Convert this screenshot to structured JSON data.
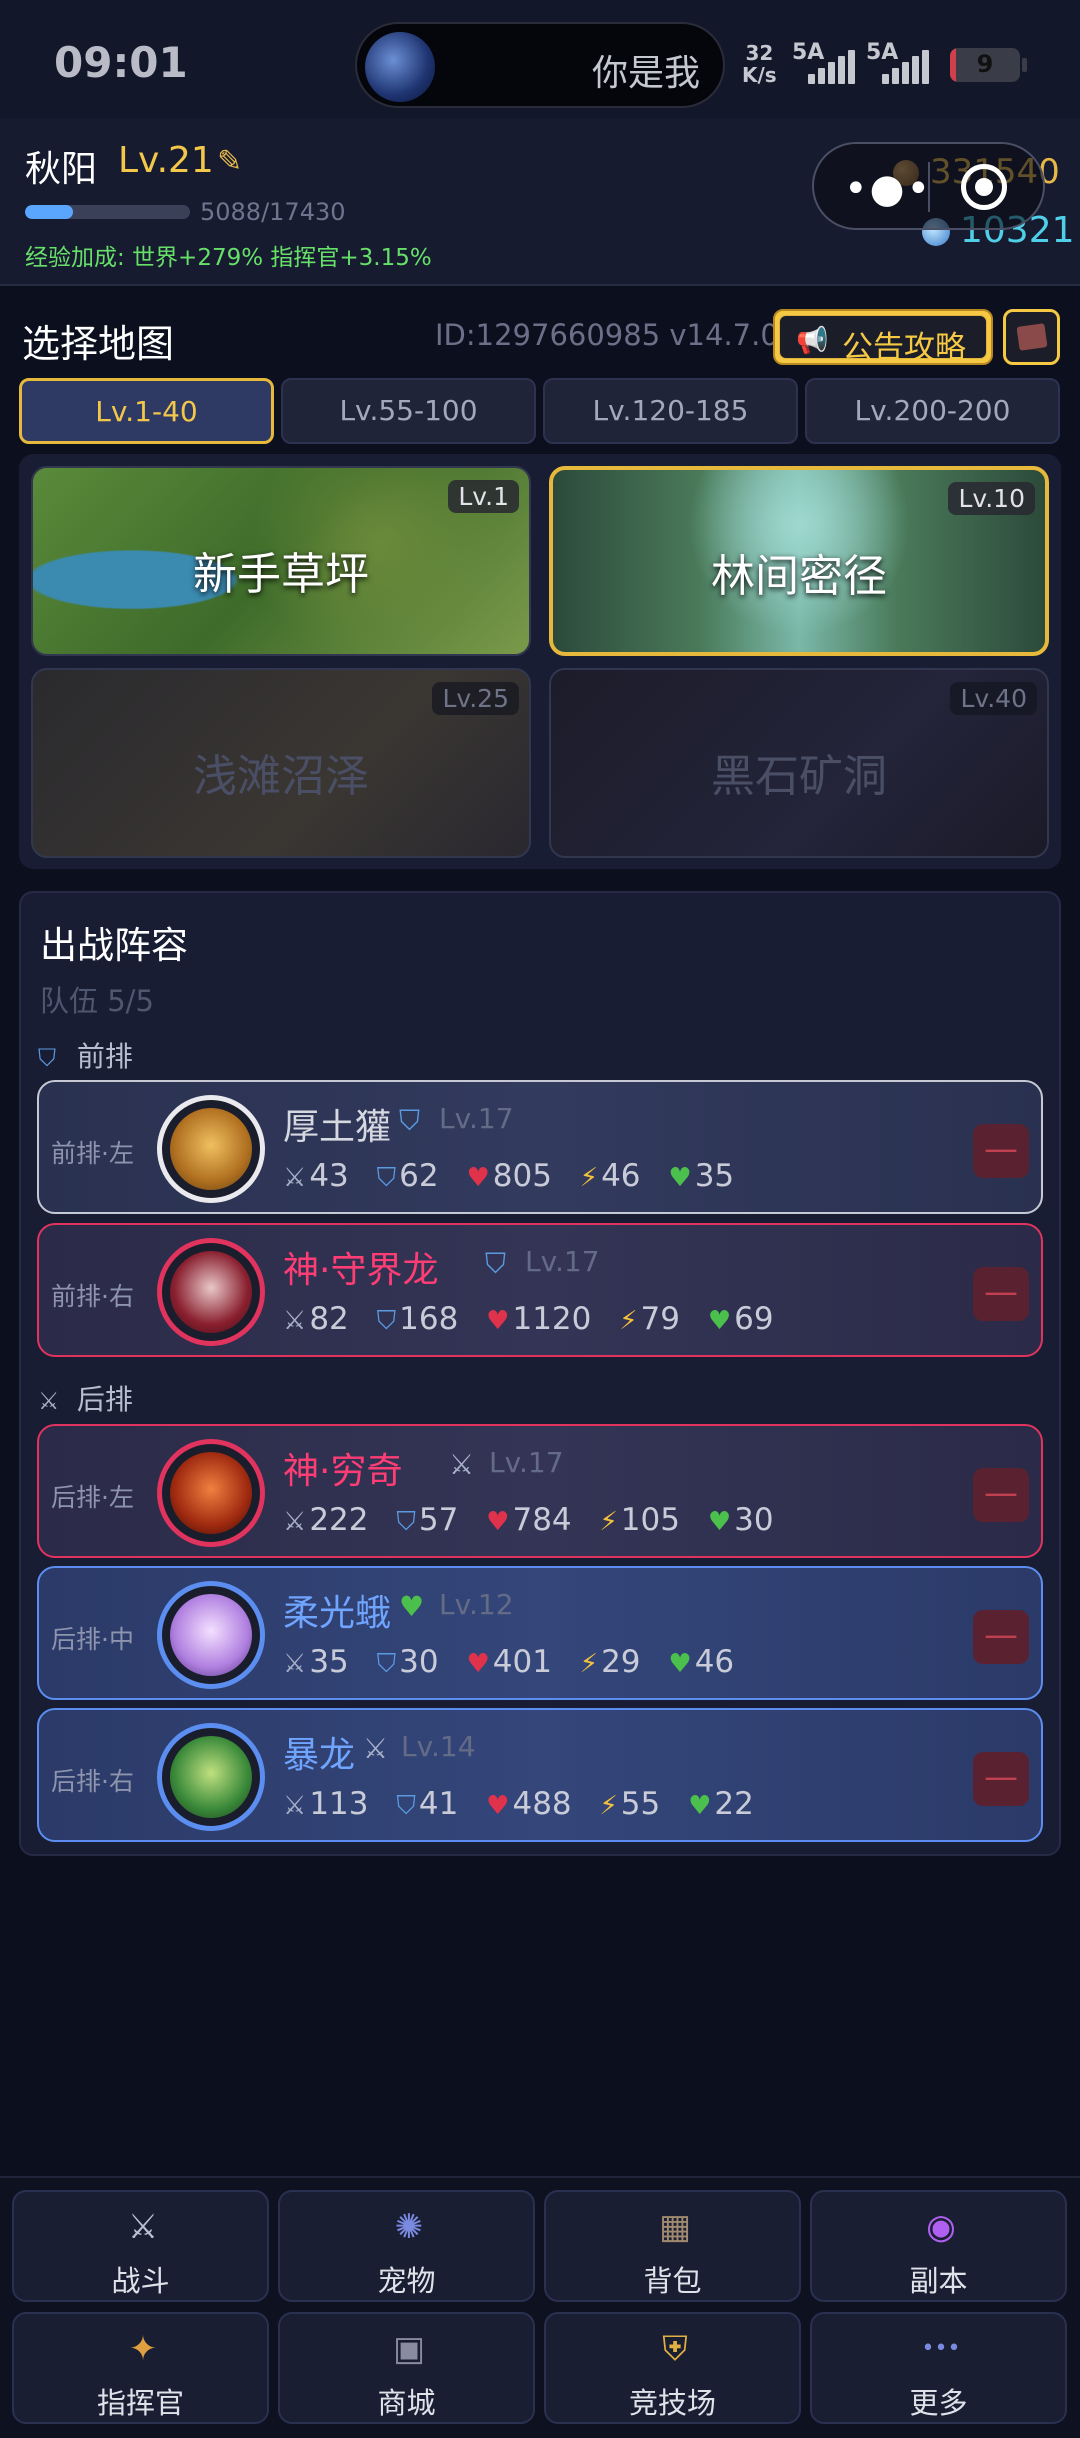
{
  "status_bar": {
    "time": "09:01",
    "island_text": "你是我",
    "net_speed_value": "32",
    "net_speed_unit": "K/s",
    "sig1": "5A",
    "sig2": "5A",
    "battery": "9",
    "battery_level": 0.09
  },
  "player": {
    "name": "秋阳",
    "level": "Lv.21",
    "xp_text": "5088/17430",
    "xp_fraction": 0.29,
    "bonus": "经验加成: 世界+279% 指挥官+3.15%",
    "coins": "331540",
    "gems": "10321"
  },
  "map_select": {
    "title": "选择地图",
    "id_version": "ID:1297660985  v14.7.0",
    "notice_label": "公告攻略",
    "tabs": [
      "Lv.1-40",
      "Lv.55-100",
      "Lv.120-185",
      "Lv.200-200"
    ],
    "active_tab": 0,
    "maps": [
      {
        "name": "新手草坪",
        "level": "Lv.1",
        "state": "unlocked",
        "theme": "meadow"
      },
      {
        "name": "林间密径",
        "level": "Lv.10",
        "state": "selected",
        "theme": "forest"
      },
      {
        "name": "浅滩沼泽",
        "level": "Lv.25",
        "state": "locked",
        "theme": "swamp"
      },
      {
        "name": "黑石矿洞",
        "level": "Lv.40",
        "state": "locked",
        "theme": "mine"
      }
    ]
  },
  "lineup": {
    "title": "出战阵容",
    "team": "队伍 5/5",
    "front_label": "前排",
    "back_label": "后排",
    "pets": [
      {
        "slot": "前排·左",
        "name": "厚土獾",
        "role": "shield-icon",
        "level": "Lv.17",
        "atk": "43",
        "def": "62",
        "hp": "805",
        "spd": "46",
        "heal": "35",
        "tier": "normal"
      },
      {
        "slot": "前排·右",
        "name": "神·守界龙",
        "role": "shield-icon",
        "level": "Lv.17",
        "atk": "82",
        "def": "168",
        "hp": "1120",
        "spd": "79",
        "heal": "69",
        "tier": "red"
      },
      {
        "slot": "后排·左",
        "name": "神·穷奇",
        "role": "swords-icon",
        "level": "Lv.17",
        "atk": "222",
        "def": "57",
        "hp": "784",
        "spd": "105",
        "heal": "30",
        "tier": "red"
      },
      {
        "slot": "后排·中",
        "name": "柔光蛾",
        "role": "heart-icon",
        "level": "Lv.12",
        "atk": "35",
        "def": "30",
        "hp": "401",
        "spd": "29",
        "heal": "46",
        "tier": "blue"
      },
      {
        "slot": "后排·右",
        "name": "暴龙",
        "role": "swords-icon",
        "level": "Lv.14",
        "atk": "113",
        "def": "41",
        "hp": "488",
        "spd": "55",
        "heal": "22",
        "tier": "blue"
      }
    ],
    "remove_symbol": "—"
  },
  "nav": [
    {
      "label": "战斗",
      "icon": "crossed-swords-icon",
      "glyph": "⚔"
    },
    {
      "label": "宠物",
      "icon": "pet-orb-icon",
      "glyph": "✺"
    },
    {
      "label": "背包",
      "icon": "backpack-icon",
      "glyph": "▦"
    },
    {
      "label": "副本",
      "icon": "portal-icon",
      "glyph": "◉"
    },
    {
      "label": "指挥官",
      "icon": "commander-icon",
      "glyph": "✦"
    },
    {
      "label": "商城",
      "icon": "shop-chest-icon",
      "glyph": "▣"
    },
    {
      "label": "竞技场",
      "icon": "arena-shield-icon",
      "glyph": "⛨"
    },
    {
      "label": "更多",
      "icon": "more-icon",
      "glyph": "•••"
    }
  ],
  "colors": {
    "gold": "#f3c74a",
    "red_tier": "#e0335e",
    "blue_tier": "#5b8ef0",
    "bonus_green": "#67e06a"
  }
}
